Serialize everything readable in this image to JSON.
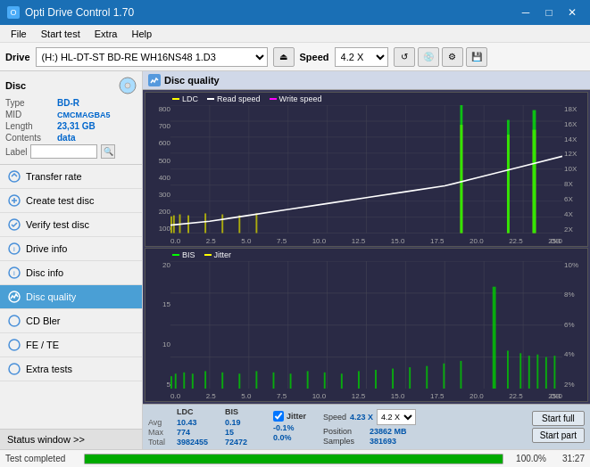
{
  "titleBar": {
    "title": "Opti Drive Control 1.70",
    "minBtn": "─",
    "maxBtn": "□",
    "closeBtn": "✕"
  },
  "menuBar": {
    "items": [
      "File",
      "Start test",
      "Extra",
      "Help"
    ]
  },
  "driveBar": {
    "label": "Drive",
    "driveValue": "(H:)  HL-DT-ST BD-RE  WH16NS48 1.D3",
    "speedLabel": "Speed",
    "speedValue": "4.2 X"
  },
  "sidebar": {
    "discSection": {
      "title": "Disc",
      "fields": [
        {
          "label": "Type",
          "value": "BD-R"
        },
        {
          "label": "MID",
          "value": "CMCMAGBA5"
        },
        {
          "label": "Length",
          "value": "23,31 GB"
        },
        {
          "label": "Contents",
          "value": "data"
        }
      ],
      "labelField": ""
    },
    "navItems": [
      {
        "id": "transfer-rate",
        "label": "Transfer rate",
        "active": false
      },
      {
        "id": "create-test-disc",
        "label": "Create test disc",
        "active": false
      },
      {
        "id": "verify-test-disc",
        "label": "Verify test disc",
        "active": false
      },
      {
        "id": "drive-info",
        "label": "Drive info",
        "active": false
      },
      {
        "id": "disc-info",
        "label": "Disc info",
        "active": false
      },
      {
        "id": "disc-quality",
        "label": "Disc quality",
        "active": true
      },
      {
        "id": "cd-bler",
        "label": "CD Bler",
        "active": false
      },
      {
        "id": "fe-te",
        "label": "FE / TE",
        "active": false
      },
      {
        "id": "extra-tests",
        "label": "Extra tests",
        "active": false
      }
    ],
    "statusWindow": "Status window >>"
  },
  "discQuality": {
    "title": "Disc quality",
    "chart1": {
      "legend": [
        {
          "label": "LDC",
          "color": "#ffff00"
        },
        {
          "label": "Read speed",
          "color": "#ffffff"
        },
        {
          "label": "Write speed",
          "color": "#ff00ff"
        }
      ],
      "yLeftLabels": [
        "800",
        "700",
        "600",
        "500",
        "400",
        "300",
        "200",
        "100"
      ],
      "yRightLabels": [
        "18X",
        "16X",
        "14X",
        "12X",
        "10X",
        "8X",
        "6X",
        "4X",
        "2X"
      ],
      "xLabels": [
        "0.0",
        "2.5",
        "5.0",
        "7.5",
        "10.0",
        "12.5",
        "15.0",
        "17.5",
        "20.0",
        "22.5"
      ],
      "gbLabel": "25.0 GB"
    },
    "chart2": {
      "legend": [
        {
          "label": "BIS",
          "color": "#00ff00"
        },
        {
          "label": "Jitter",
          "color": "#ffff00"
        }
      ],
      "yLeftLabels": [
        "20",
        "15",
        "10",
        "5"
      ],
      "yRightLabels": [
        "10%",
        "8%",
        "6%",
        "4%",
        "2%"
      ],
      "xLabels": [
        "0.0",
        "2.5",
        "5.0",
        "7.5",
        "10.0",
        "12.5",
        "15.0",
        "17.5",
        "20.0",
        "22.5"
      ],
      "gbLabel": "25.0 GB"
    }
  },
  "stats": {
    "headers": [
      "",
      "LDC",
      "BIS",
      "",
      "Jitter",
      "Speed",
      ""
    ],
    "rows": [
      {
        "label": "Avg",
        "ldc": "10.43",
        "bis": "0.19",
        "jitter": "-0.1%"
      },
      {
        "label": "Max",
        "ldc": "774",
        "bis": "15",
        "jitter": "0.0%"
      },
      {
        "label": "Total",
        "ldc": "3982455",
        "bis": "72472",
        "jitter": ""
      }
    ],
    "jitterLabel": "Jitter",
    "speedValue": "4.23 X",
    "speedSelectValue": "4.2 X",
    "positionLabel": "Position",
    "positionValue": "23862 MB",
    "samplesLabel": "Samples",
    "samplesValue": "381693",
    "startFullBtn": "Start full",
    "startPartBtn": "Start part"
  },
  "bottomBar": {
    "statusText": "Test completed",
    "progressValue": 100,
    "timeText": "31:27"
  }
}
